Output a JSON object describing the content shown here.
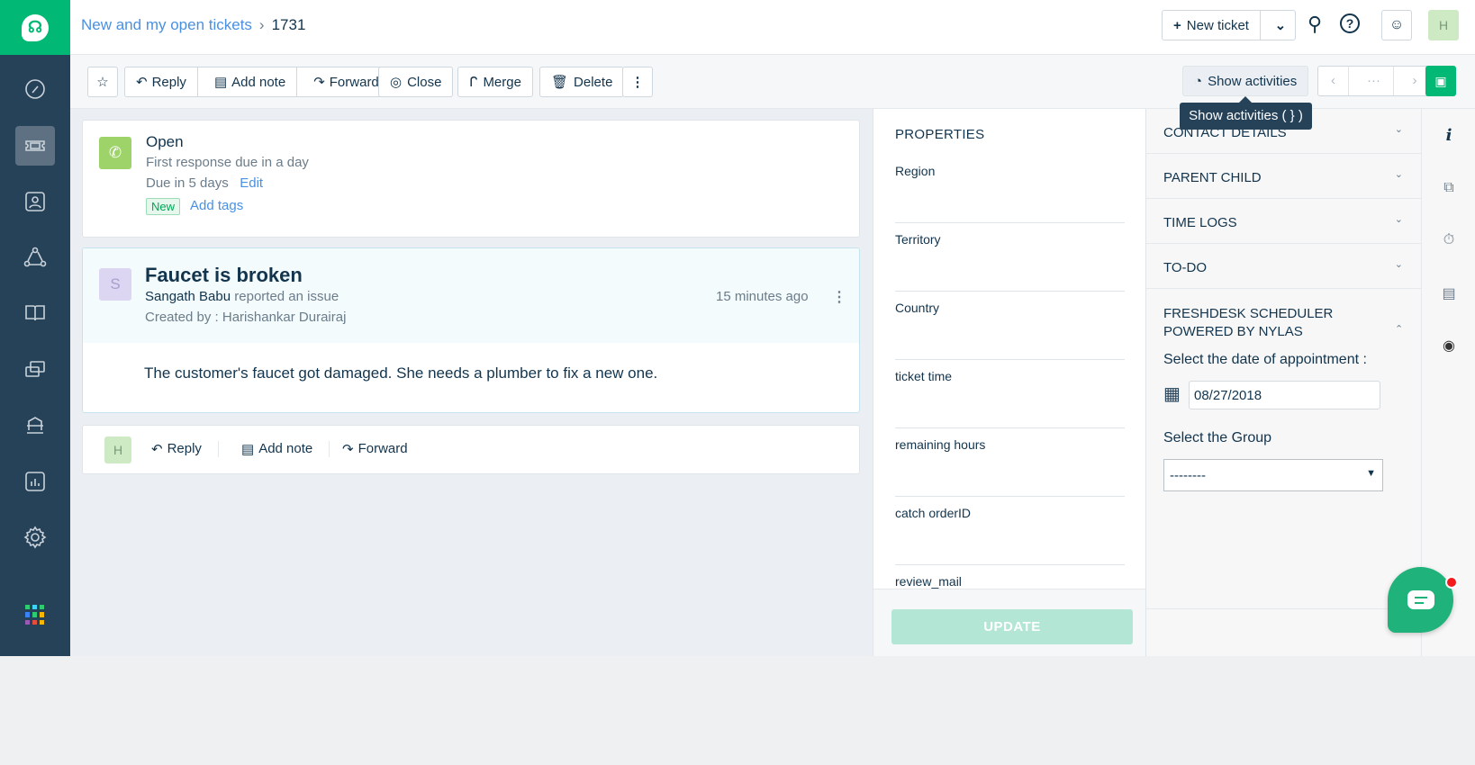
{
  "header": {
    "breadcrumb_link": "New and my open tickets",
    "ticket_id": "1731",
    "new_ticket": "New ticket",
    "avatar_initial": "H"
  },
  "toolbar": {
    "reply": "Reply",
    "add_note": "Add note",
    "forward": "Forward",
    "close": "Close",
    "merge": "Merge",
    "delete": "Delete",
    "show_activities": "Show activities",
    "tooltip": "Show activities ( } )",
    "pager_dots": "···"
  },
  "status_card": {
    "status": "Open",
    "first_response": "First response due in a day",
    "due": "Due in 5 days",
    "edit": "Edit",
    "tag": "New",
    "add_tags": "Add tags"
  },
  "ticket": {
    "avatar": "S",
    "subject": "Faucet is broken",
    "requester": "Sangath Babu",
    "action": "reported an issue",
    "created_by": "Created by : Harishankar Durairaj",
    "time": "15 minutes ago",
    "body": "The customer's faucet got damaged. She needs a plumber to fix a new one."
  },
  "reply_bar": {
    "avatar": "H",
    "reply": "Reply",
    "add_note": "Add note",
    "forward": "Forward"
  },
  "properties": {
    "title": "PROPERTIES",
    "fields": [
      "Region",
      "Territory",
      "Country",
      "ticket time",
      "remaining hours",
      "catch orderID",
      "review_mail"
    ],
    "update": "UPDATE"
  },
  "right_panel": {
    "sections": [
      "CONTACT DETAILS",
      "PARENT CHILD",
      "TIME LOGS",
      "TO-DO"
    ],
    "scheduler_title_1": "FRESHDESK SCHEDULER",
    "scheduler_title_2": "POWERED BY NYLAS",
    "date_label": "Select the date of appointment :",
    "date_value": "08/27/2018",
    "group_label": "Select the Group",
    "group_value": "--------"
  },
  "colors": {
    "brand": "#02b875",
    "sidebar": "#264259",
    "link": "#4a90e2"
  }
}
